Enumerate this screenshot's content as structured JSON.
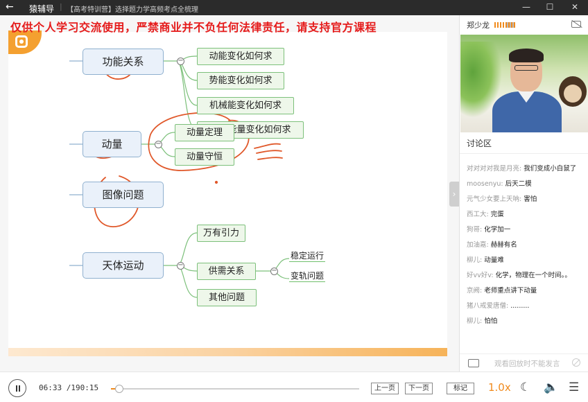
{
  "titlebar": {
    "back_icon": "arrow-left",
    "app_name": "猿辅导",
    "separator": "|",
    "course_title": "【高考特训营】选择题力学高频考点全梳理",
    "minimize_icon": "—",
    "maximize_icon": "☐",
    "close_icon": "✕"
  },
  "slide": {
    "watermark": "仅供个人学习交流使用，严禁商业并不负任何法律责任，请支持官方课程",
    "mindmap": {
      "topics": [
        {
          "label": "功能关系",
          "children": [
            "动能变化如何求",
            "势能变化如何求",
            "机械能变化如何求",
            "其他能量变化如何求"
          ]
        },
        {
          "label": "动量",
          "children": [
            "动量定理",
            "动量守恒"
          ]
        },
        {
          "label": "图像问题",
          "children": []
        },
        {
          "label": "天体运动",
          "children": [
            "万有引力",
            "供需关系",
            "其他问题"
          ],
          "subchildren": [
            "稳定运行",
            "变轨问题"
          ]
        }
      ],
      "collapse_symbol": "−"
    },
    "expand_icon": "›"
  },
  "sidebar": {
    "teacher_name": "郑少龙",
    "discussion_title": "讨论区",
    "messages": [
      {
        "user": "对对对对我是月亮:",
        "text": "我们变成小白鼠了"
      },
      {
        "user": "moosenyu:",
        "text": "后天二模"
      },
      {
        "user": "元气少女要上天呐:",
        "text": "害怕"
      },
      {
        "user": "西工大:",
        "text": "完蛋"
      },
      {
        "user": "狗哥:",
        "text": "化学加一"
      },
      {
        "user": "加油嘉:",
        "text": "赫赫有名"
      },
      {
        "user": "柳儿:",
        "text": "动量难"
      },
      {
        "user": "好vv好v:",
        "text": "化学，物理在一个时间。。"
      },
      {
        "user": "京阙:",
        "text": "老师重点讲下动量"
      },
      {
        "user": "猪八戒爱唐僧:",
        "text": "........."
      },
      {
        "user": "柳儿:",
        "text": "怕怕"
      }
    ],
    "input_placeholder": "观看回放时不能发言"
  },
  "controls": {
    "current_time": "06:33",
    "duration": "/190:15",
    "progress": 0.034,
    "prev_page": "上一页",
    "next_page": "下一页",
    "mark": "标记",
    "speed": "1.0x"
  }
}
